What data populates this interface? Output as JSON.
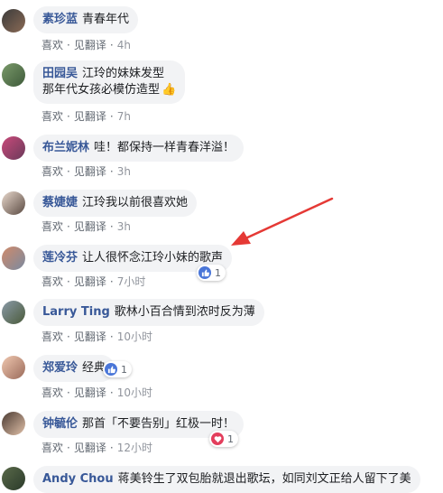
{
  "actions": {
    "like": "喜欢",
    "translate": "见翻译"
  },
  "comments": [
    {
      "author": "素珍蓝",
      "text": "青春年代",
      "time": "4h"
    },
    {
      "author": "田园吴",
      "text": "江玲的妹妹发型",
      "text2": "那年代女孩必模仿造型",
      "time": "7h"
    },
    {
      "author": "布兰妮林",
      "text": "哇！都保持一样青春洋溢！",
      "time": "3h"
    },
    {
      "author": "蔡婕婕",
      "text": "江玲我以前很喜欢她",
      "time": "3h"
    },
    {
      "author": "莲冷芬",
      "text": "让人很怀念江玲小妹的歌声",
      "time": "7小时",
      "reaction": {
        "icon": "like-icon",
        "count": "1"
      }
    },
    {
      "author": "Larry Ting",
      "text": "歌林小百合情到浓时反为薄",
      "time": "10小时"
    },
    {
      "author": "郑爱玲",
      "text": "经典",
      "time": "10小时",
      "reaction": {
        "icon": "like-icon",
        "count": "1"
      }
    },
    {
      "author": "钟毓伦",
      "text": "那首「不要告别」红极一时！",
      "time": "12小时",
      "reaction": {
        "icon": "love-icon",
        "count": "1"
      }
    },
    {
      "author": "Andy Chou",
      "text": "蒋美铃生了双包胎就退出歌坛，如同刘文正给人留下了美"
    }
  ],
  "colors": {
    "author": "#385898",
    "bubble": "#f2f3f5",
    "like": "#4a76d8",
    "love": "#e33e5c",
    "arrow": "#e53935"
  }
}
